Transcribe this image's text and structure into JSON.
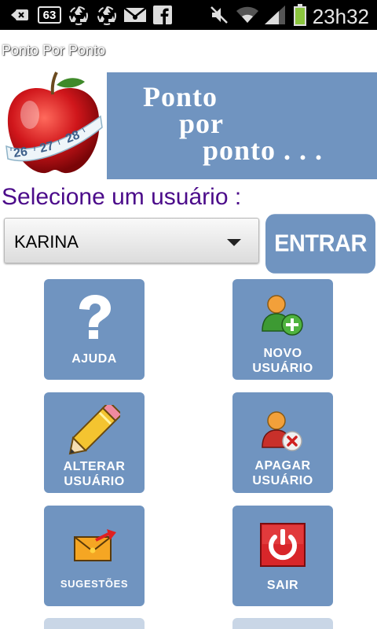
{
  "status_bar": {
    "notification_count": "63",
    "time": "23h32",
    "icons": [
      "back-arrow-icon",
      "recycle-icon",
      "recycle-icon",
      "mail-icon",
      "facebook-icon",
      "mute-icon",
      "wifi-icon",
      "signal-icon",
      "battery-icon"
    ]
  },
  "app": {
    "title": "Ponto Por Ponto"
  },
  "banner": {
    "line1": "Ponto",
    "line2": "por",
    "line3": "ponto . . ."
  },
  "user_select": {
    "label": "Selecione um usuário :",
    "selected": "KARINA",
    "enter_label": "ENTRAR"
  },
  "tiles": {
    "help": {
      "label": "AJUDA"
    },
    "new_user": {
      "line1": "NOVO",
      "line2": "USUÁRIO"
    },
    "edit_user": {
      "line1": "ALTERAR",
      "line2": "USUÁRIO"
    },
    "delete_user": {
      "line1": "APAGAR",
      "line2": "USUÁRIO"
    },
    "suggestions": {
      "label": "SUGESTÕES"
    },
    "exit": {
      "label": "SAIR"
    }
  },
  "colors": {
    "tile_blue": "#7094c0",
    "label_purple": "#4b0b8a",
    "exit_red": "#d8262a"
  }
}
